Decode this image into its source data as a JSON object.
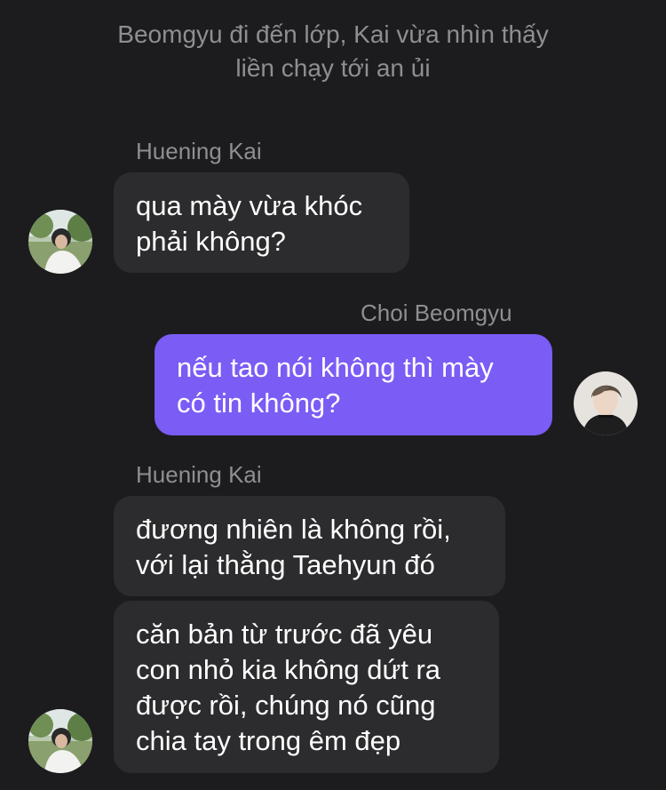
{
  "narration": {
    "line1": "Beomgyu đi đến lớp, Kai vừa nhìn thấy",
    "line2": "liền chạy tới an ủi"
  },
  "messages": [
    {
      "sender": "Huening Kai",
      "side": "left",
      "lines": [
        "qua mày vừa khóc",
        "phải không?"
      ],
      "avatar_icon": "huening-kai-avatar"
    },
    {
      "sender": "Choi Beomgyu",
      "side": "right",
      "lines": [
        "nếu tao nói không thì mày",
        "có tin không?"
      ],
      "avatar_icon": "choi-beomgyu-avatar"
    },
    {
      "sender": "Huening Kai",
      "side": "left",
      "lines": [
        "đương nhiên là không rồi,",
        "với lại thằng Taehyun đó"
      ]
    },
    {
      "side": "left",
      "lines": [
        "căn bản từ trước đã yêu",
        "con nhỏ kia không dứt ra",
        "được rồi, chúng nó cũng",
        "chia tay trong êm đẹp"
      ],
      "avatar_icon": "huening-kai-avatar"
    }
  ],
  "colors": {
    "background": "#1c1c1e",
    "incoming_bubble": "#2c2c2e",
    "outgoing_bubble": "#7b5cf5",
    "secondary_text": "#8e8e93"
  }
}
